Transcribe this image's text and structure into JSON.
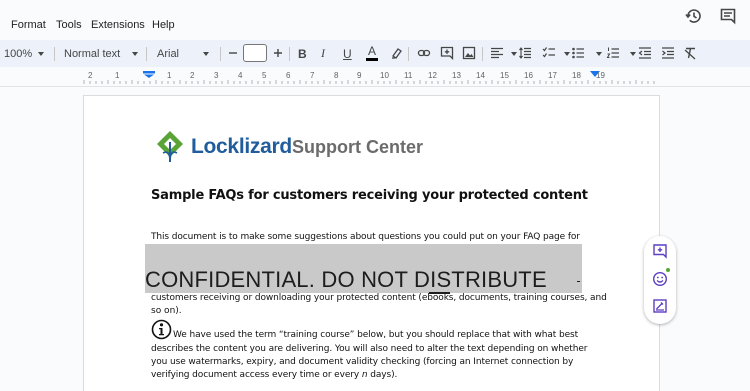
{
  "menu": {
    "items": [
      "Format",
      "Tools",
      "Extensions",
      "Help"
    ]
  },
  "header_icons": [
    "history-icon",
    "comments-icon"
  ],
  "toolbar": {
    "zoom": "100%",
    "style": "Normal text",
    "font": "Arial",
    "font_size": "",
    "icons": [
      "minus-icon",
      "plus-icon",
      "bold-icon",
      "italic-icon",
      "underline-icon",
      "text-color-icon",
      "highlight-icon",
      "link-icon",
      "add-comment-icon",
      "insert-image-icon",
      "align-icon",
      "line-spacing-icon",
      "checklist-icon",
      "bullet-list-icon",
      "numbered-list-icon",
      "decrease-indent-icon",
      "increase-indent-icon",
      "clear-formatting-icon"
    ]
  },
  "ruler": {
    "numbers": [
      "2",
      "1",
      "1",
      "2",
      "3",
      "4",
      "5",
      "6",
      "7",
      "8",
      "9",
      "10",
      "11",
      "12",
      "13",
      "14",
      "15",
      "16",
      "17",
      "18",
      "19"
    ]
  },
  "document": {
    "logo_brand": "Locklizard",
    "logo_suffix": "Support Center",
    "heading": "Sample FAQs for customers receiving your protected content",
    "intro": "This document is to make some suggestions about questions you could put on your FAQ page for",
    "watermark": "CONFIDENTIAL. DO NOT DISTRIBUTE",
    "para1_line1": "customers receiving or downloading your protected content (ebooks, documents, training courses, and",
    "para1_line2": "so on).",
    "note_line1": "We have used the term “training course” below, but you should replace that with what best",
    "note_line2": "describes  the content you are delivering. You will also need to alter the text depending on whether",
    "note_line3": "you use  watermarks, expiry, and document validity checking (forcing an Internet connection by",
    "note_line4_a": "verifying  document access every time or every ",
    "note_line4_b": "n",
    "note_line4_c": " days)."
  },
  "side_panel": {
    "icons": [
      "add-comment-icon",
      "emoji-icon",
      "suggest-edit-icon"
    ]
  },
  "colors": {
    "toolbar_bg": "#edf2fa",
    "accent": "#1a73e8",
    "side_icon": "#5d3ec2",
    "logo_green": "#5aa437",
    "logo_blue": "#215d9c",
    "watermark_band": "#c9c9c9"
  }
}
